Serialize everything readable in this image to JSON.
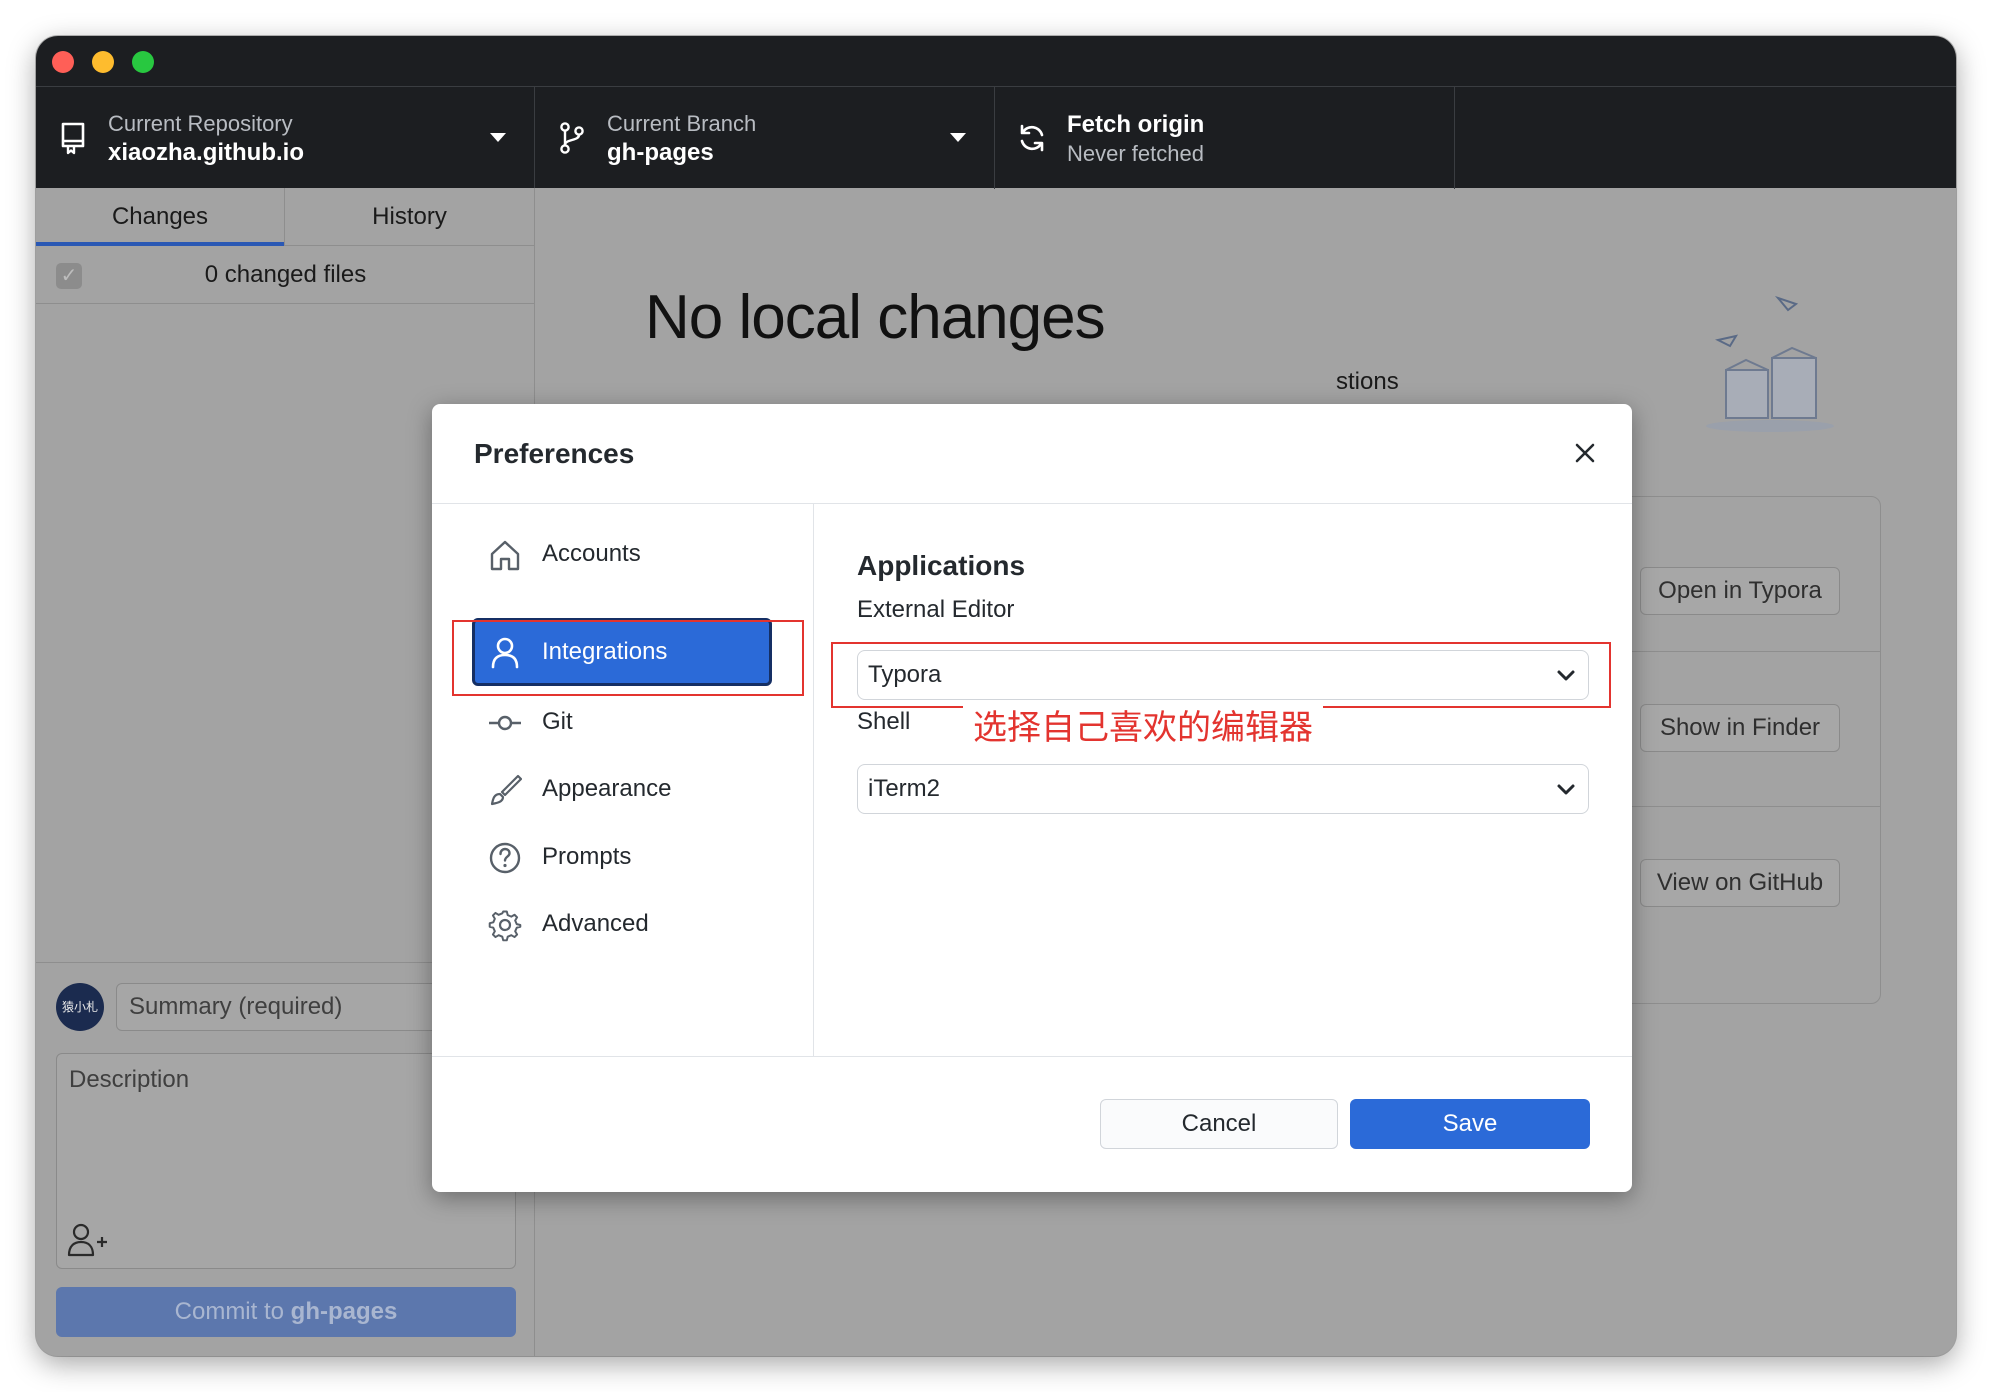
{
  "toolbar": {
    "repo": {
      "label": "Current Repository",
      "value": "xiaozha.github.io"
    },
    "branch": {
      "label": "Current Branch",
      "value": "gh-pages"
    },
    "fetch": {
      "title": "Fetch origin",
      "status": "Never fetched"
    }
  },
  "sidebar": {
    "tabs": [
      {
        "label": "Changes"
      },
      {
        "label": "History"
      }
    ],
    "changed_files": "0 changed files",
    "avatar_text": "猿小札",
    "summary_placeholder": "Summary (required)",
    "description_placeholder": "Description",
    "commit_button": {
      "prefix": "Commit to ",
      "branch": "gh-pages"
    }
  },
  "main": {
    "heading": "No local changes",
    "suggestions_fragment": "stions",
    "actions": [
      {
        "label": "Open in Typora"
      },
      {
        "label": "Show in Finder"
      },
      {
        "label": "View on GitHub"
      }
    ]
  },
  "dialog": {
    "title": "Preferences",
    "nav": [
      {
        "label": "Accounts",
        "icon": "home-icon"
      },
      {
        "label": "Integrations",
        "icon": "person-icon"
      },
      {
        "label": "Git",
        "icon": "git-commit-icon"
      },
      {
        "label": "Appearance",
        "icon": "paintbrush-icon"
      },
      {
        "label": "Prompts",
        "icon": "question-icon"
      },
      {
        "label": "Advanced",
        "icon": "gear-icon"
      }
    ],
    "active_nav": "Integrations",
    "section_title": "Applications",
    "external_editor": {
      "label": "External Editor",
      "value": "Typora"
    },
    "shell": {
      "label": "Shell",
      "value": "iTerm2"
    },
    "annotation": "选择自己喜欢的编辑器",
    "cancel": "Cancel",
    "save": "Save"
  },
  "colors": {
    "accent": "#2b6ad8",
    "toolbar_bg": "#1c1e21",
    "annotation_red": "#e3342f",
    "overlay_bg": "#a3a3a3"
  }
}
